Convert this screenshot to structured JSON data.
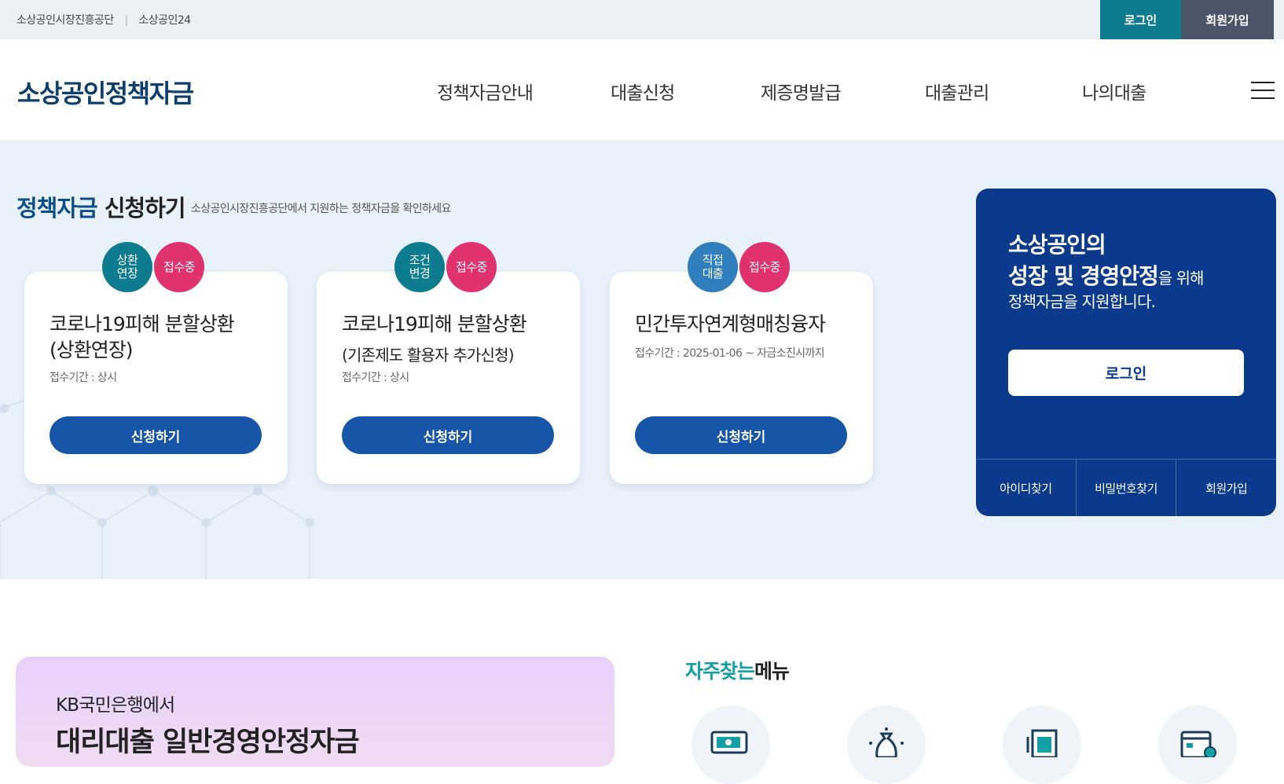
{
  "utility": {
    "links": [
      "소상공인시장진흥공단",
      "소상공인24"
    ],
    "login_label": "로그인",
    "join_label": "회원가입"
  },
  "header": {
    "logo": "소상공인정책자금",
    "nav": [
      "정책자금안내",
      "대출신청",
      "제증명발급",
      "대출관리",
      "나의대출"
    ]
  },
  "hero": {
    "title_highlight": "정책자금",
    "title_rest": " 신청하기",
    "subtitle": "소상공인시장진흥공단에서 지원하는 정책자금을 확인하세요",
    "cards": [
      {
        "badge_type": "상환\n연장",
        "badge_type_color": "#0d7c8f",
        "badge_status": "접수중",
        "badge_status_color": "#e0336e",
        "title": "코로나19피해 분할상환\n(상환연장)",
        "title_sub": "",
        "period": "접수기간 : 상시",
        "button": "신청하기"
      },
      {
        "badge_type": "조건\n변경",
        "badge_type_color": "#0d7c8f",
        "badge_status": "접수중",
        "badge_status_color": "#e0336e",
        "title": "코로나19피해 분할상환",
        "title_sub": "(기존제도 활용자 추가신청)",
        "period": "접수기간 : 상시",
        "button": "신청하기"
      },
      {
        "badge_type": "직접\n대출",
        "badge_type_color": "#2f7fbf",
        "badge_status": "접수중",
        "badge_status_color": "#e0336e",
        "title": "민간투자연계형매칭융자",
        "title_sub": "",
        "period": "접수기간 : 2025-01-06 ~ 자금소진시까지",
        "button": "신청하기"
      }
    ]
  },
  "login_panel": {
    "line1": "소상공인의",
    "line2_bold": "성장 및 경영안정",
    "line2_small": "을 위해",
    "line3": "정책자금을 지원합니다.",
    "login_button": "로그인",
    "links": [
      "아이디찾기",
      "비밀번호찾기",
      "회원가입"
    ]
  },
  "promo": {
    "subtitle": "KB국민은행에서",
    "title": "대리대출 일반경영안정자금"
  },
  "favorites": {
    "title_highlight": "자주찾는",
    "title_rest": "메뉴",
    "icons": [
      "money-transfer-icon",
      "money-bag-icon",
      "document-icon",
      "calendar-icon"
    ]
  },
  "colors": {
    "primary": "#1655a8",
    "navy": "#0b3a8c",
    "teal": "#0d7c8f",
    "status_pink": "#e0336e"
  }
}
